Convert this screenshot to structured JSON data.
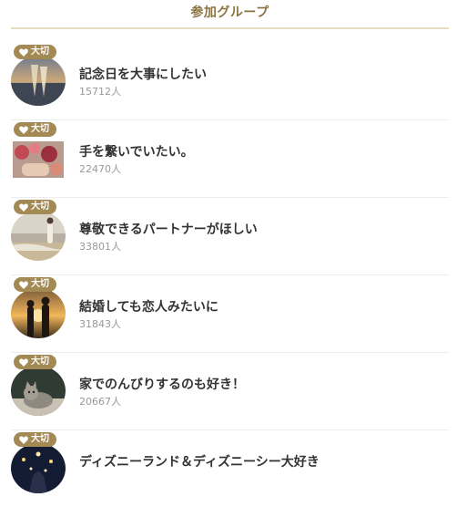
{
  "header": {
    "title": "参加グループ"
  },
  "badge_label": "大切",
  "groups": [
    {
      "title": "記念日を大事にしたい",
      "count": "15712人",
      "icon": "champagne-sunset-image"
    },
    {
      "title": "手を繋いでいたい。",
      "count": "22470人",
      "icon": "flowers-hands-image"
    },
    {
      "title": "尊敬できるパートナーがほしい",
      "count": "33801人",
      "icon": "beach-couple-image"
    },
    {
      "title": "結婚しても恋人みたいに",
      "count": "31843人",
      "icon": "sunset-silhouette-image"
    },
    {
      "title": "家でのんびりするのも好き！",
      "count": "20667人",
      "icon": "cat-image"
    },
    {
      "title": "ディズニーランド＆ディズニーシー大好き",
      "count": "",
      "icon": "night-lights-image"
    }
  ],
  "colors": {
    "accent": "#a38a55",
    "title": "#8a7340",
    "divider": "#e6dcc0"
  }
}
